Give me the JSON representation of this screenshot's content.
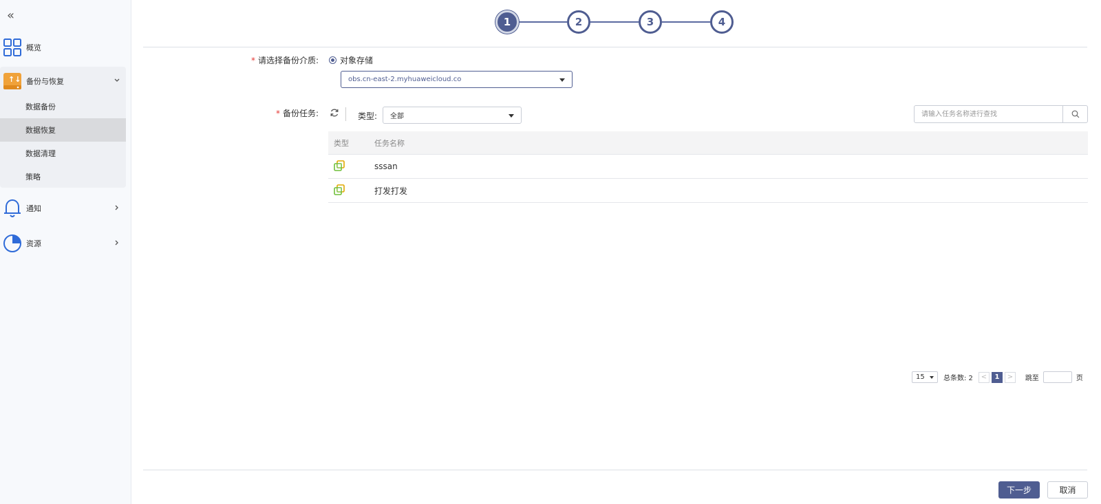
{
  "sidebar": {
    "collapse_glyph": "«",
    "items": [
      {
        "label": "概览",
        "icon": "grid-icon"
      },
      {
        "label": "备份与恢复",
        "icon": "backup-drive-icon"
      },
      {
        "label": "通知",
        "icon": "bell-icon"
      },
      {
        "label": "资源",
        "icon": "pie-chart-icon"
      }
    ],
    "sub_items": [
      {
        "label": "数据备份"
      },
      {
        "label": "数据恢复",
        "active": true
      },
      {
        "label": "数据清理"
      },
      {
        "label": "策略"
      }
    ]
  },
  "steps": [
    "1",
    "2",
    "3",
    "4"
  ],
  "form": {
    "medium_label": "请选择备份介质:",
    "medium_option": "对象存储",
    "endpoint_value": "obs.cn-east-2.myhuaweicloud.co",
    "task_label": "备份任务:",
    "type_label": "类型:",
    "type_value": "全部",
    "search_placeholder": "请输入任务名称进行查找"
  },
  "table": {
    "headers": [
      "类型",
      "任务名称"
    ],
    "rows": [
      {
        "name": "sssan"
      },
      {
        "name": "打发打发"
      }
    ]
  },
  "pager": {
    "page_size": "15",
    "total_label": "总条数: 2",
    "current_page": "1",
    "prev": "<",
    "next": ">",
    "jump_label": "跳至",
    "page_suffix": "页"
  },
  "buttons": {
    "next": "下一步",
    "cancel": "取消"
  },
  "colors": {
    "primary": "#4f5d91",
    "required": "#e53935",
    "accent_orange": "#f0a23a",
    "nav_blue": "#2f6bd8"
  }
}
